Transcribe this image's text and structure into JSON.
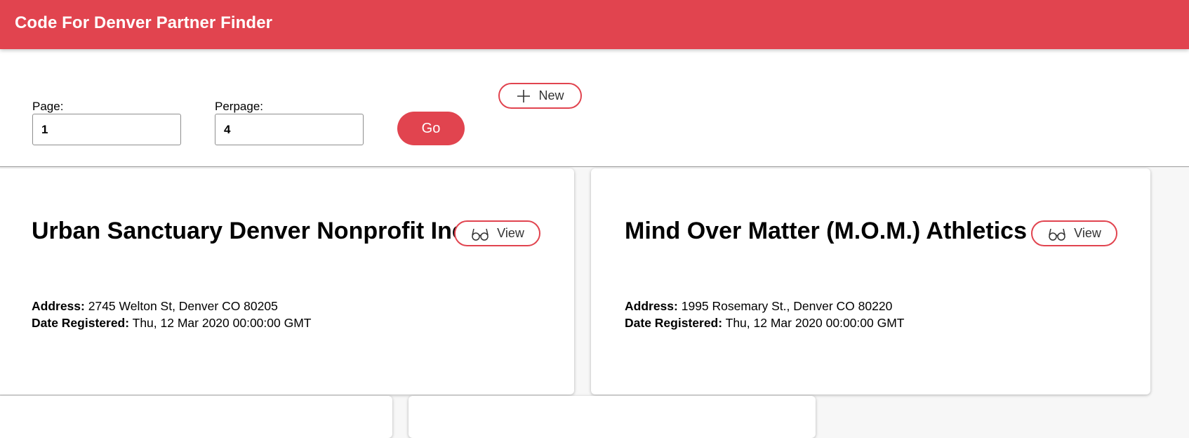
{
  "app": {
    "title": "Code For Denver Partner Finder"
  },
  "controls": {
    "page_label": "Page:",
    "page_value": "1",
    "perpage_label": "Perpage:",
    "perpage_value": "4",
    "go_label": "Go",
    "new_label": "New",
    "new_icon": "plus-icon"
  },
  "partners": [
    {
      "name": "Urban Sanctuary Denver Nonprofit Inc",
      "view_label": "View",
      "view_icon": "glasses-icon",
      "address_label": "Address:",
      "address": "2745 Welton St, Denver CO 80205",
      "date_label": "Date Registered:",
      "date": "Thu, 12 Mar 2020 00:00:00 GMT"
    },
    {
      "name": "Mind Over Matter (M.O.M.) Athletics",
      "view_label": "View",
      "view_icon": "glasses-icon",
      "address_label": "Address:",
      "address": "1995 Rosemary St., Denver CO 80220",
      "date_label": "Date Registered:",
      "date": "Thu, 12 Mar 2020 00:00:00 GMT"
    }
  ],
  "colors": {
    "brand": "#e1444f",
    "background": "#f7f7f7"
  }
}
